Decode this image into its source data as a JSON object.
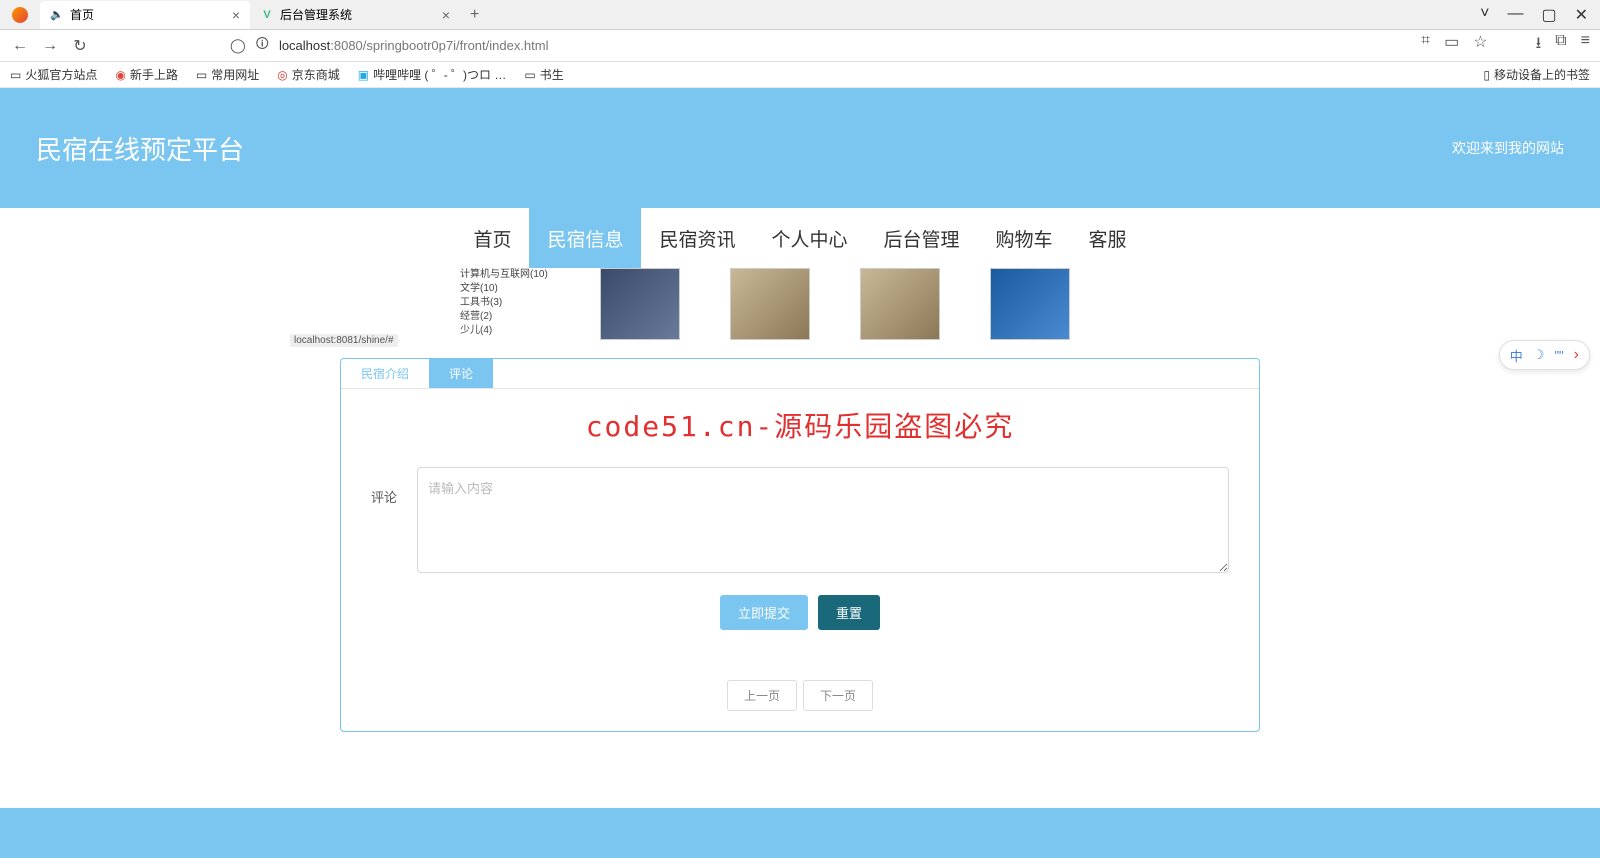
{
  "browser": {
    "tabs": [
      {
        "title": "首页",
        "icon": "🔈"
      },
      {
        "title": "后台管理系统",
        "icon": "V"
      }
    ],
    "window_controls": {
      "min": "—",
      "max": "▢",
      "close": "✕",
      "chev": "˅"
    },
    "nav": {
      "back": "←",
      "fwd": "→",
      "reload": "↻"
    },
    "url_host": "localhost",
    "url_port_path": ":8080/springbootr0p7i/front/index.html",
    "addr_icons": {
      "qr": "⌗",
      "reader": "▭",
      "star": "☆",
      "dl": "⭳",
      "ext": "⧉",
      "menu": "≡"
    }
  },
  "bookmarks": {
    "items": [
      "火狐官方站点",
      "新手上路",
      "常用网址",
      "京东商城",
      "哔哩哔哩 ( ゜- ゜)つロ …",
      "书生"
    ],
    "right": "移动设备上的书签"
  },
  "header": {
    "title": "民宿在线预定平台",
    "welcome": "欢迎来到我的网站"
  },
  "nav_items": [
    "首页",
    "民宿信息",
    "民宿资讯",
    "个人中心",
    "后台管理",
    "购物车",
    "客服"
  ],
  "cats": [
    "计算机与互联网(10)",
    "文学(10)",
    "工具书(3)",
    "经营(2)",
    "少儿(4)"
  ],
  "small_addr": "localhost:8081/shine/#",
  "card": {
    "tabs": [
      "民宿介绍",
      "评论"
    ],
    "banner": "code51.cn-源码乐园盗图必究",
    "label": "评论",
    "placeholder": "请输入内容",
    "submit": "立即提交",
    "reset": "重置",
    "prev": "上一页",
    "next": "下一页"
  },
  "ime": {
    "lang": "中",
    "moon": "☽",
    "quotes": "\"\""
  }
}
